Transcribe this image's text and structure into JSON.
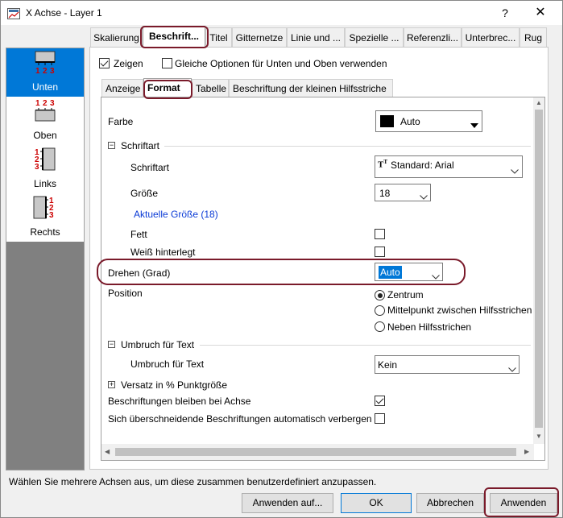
{
  "window": {
    "title": "X Achse - Layer 1",
    "help": "?",
    "close": "✕"
  },
  "sidebar": {
    "items": [
      {
        "label": "Unten",
        "icon": "axis-bottom-icon",
        "selected": true
      },
      {
        "label": "Oben",
        "icon": "axis-top-icon",
        "selected": false
      },
      {
        "label": "Links",
        "icon": "axis-left-icon",
        "selected": false
      },
      {
        "label": "Rechts",
        "icon": "axis-right-icon",
        "selected": false
      }
    ]
  },
  "tabs": {
    "items": [
      "Skalierung",
      "Beschrift...",
      "Titel",
      "Gitternetze",
      "Linie und ...",
      "Spezielle ...",
      "Referenzli...",
      "Unterbrec...",
      "Rug"
    ],
    "active_index": 1
  },
  "options": {
    "show_label": "Zeigen",
    "show_checked": true,
    "same_options_label": "Gleiche Optionen für Unten und Oben verwenden",
    "same_options_checked": false
  },
  "subtabs": {
    "items": [
      "Anzeige",
      "Format",
      "Tabelle",
      "Beschriftung der kleinen Hilfsstriche"
    ],
    "active_index": 1
  },
  "format": {
    "color_label": "Farbe",
    "color_value": "Auto",
    "color_swatch": "#000000",
    "font_section": "Schriftart",
    "font_label": "Schriftart",
    "font_value": "Standard: Arial",
    "size_label": "Größe",
    "size_value": "18",
    "actual_size_link": "Aktuelle Größe (18)",
    "bold_label": "Fett",
    "bold_checked": false,
    "white_bg_label": "Weiß hinterlegt",
    "white_bg_checked": false,
    "rotate_label": "Drehen (Grad)",
    "rotate_value": "Auto",
    "position_label": "Position",
    "position_options": [
      "Zentrum",
      "Mittelpunkt zwischen Hilfsstrichen",
      "Neben Hilfsstrichen"
    ],
    "position_selected": 0,
    "wrap_section": "Umbruch für Text",
    "wrap_label": "Umbruch für Text",
    "wrap_value": "Kein",
    "offset_section": "Versatz in % Punktgröße",
    "stay_with_axis_label": "Beschriftungen bleiben bei Achse",
    "stay_with_axis_checked": true,
    "hide_overlap_label": "Sich überschneidende Beschriftungen automatisch verbergen",
    "hide_overlap_checked": false
  },
  "status": {
    "text": "Wählen Sie mehrere Achsen aus, um diese zusammen benutzerdefiniert anzupassen."
  },
  "buttons": {
    "apply_to": "Anwenden auf...",
    "ok": "OK",
    "cancel": "Abbrechen",
    "apply": "Anwenden"
  },
  "colors": {
    "accent": "#0078d7",
    "highlight": "#7a1a2a",
    "link": "#0000ee"
  }
}
